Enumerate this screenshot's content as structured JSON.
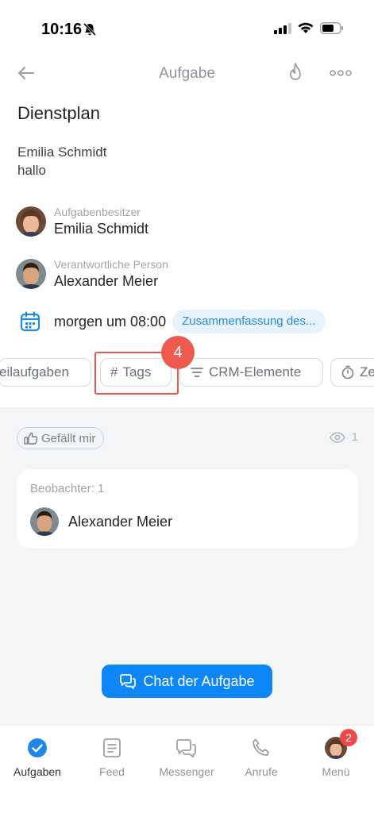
{
  "status": {
    "time": "10:16"
  },
  "header": {
    "title": "Aufgabe"
  },
  "task": {
    "title": "Dienstplan",
    "description_line1": "Emilia Schmidt",
    "description_line2": "hallo"
  },
  "owner": {
    "role": "Aufgabenbesitzer",
    "name": "Emilia Schmidt"
  },
  "responsible": {
    "role": "Verantwortliche Person",
    "name": "Alexander Meier"
  },
  "deadline": {
    "text": "morgen um 08:00",
    "summary": "Zusammenfassung des..."
  },
  "chips": {
    "subtasks": "eilaufgaben",
    "tags": "Tags",
    "crm": "CRM-Elemente",
    "time": "Ze"
  },
  "step_badge": "4",
  "like": {
    "label": "Gefällt mir"
  },
  "views": {
    "count": "1"
  },
  "observers": {
    "label": "Beobachter: 1",
    "name": "Alexander Meier"
  },
  "chat_button": {
    "label": "Chat der Aufgabe"
  },
  "tabbar": {
    "tasks": "Aufgaben",
    "feed": "Feed",
    "messenger": "Messenger",
    "calls": "Anrufe",
    "menu": "Menü",
    "menu_badge": "2"
  },
  "colors": {
    "accent": "#0d86f7",
    "highlight": "#ef5a4f",
    "badge": "#ef4a4a"
  }
}
